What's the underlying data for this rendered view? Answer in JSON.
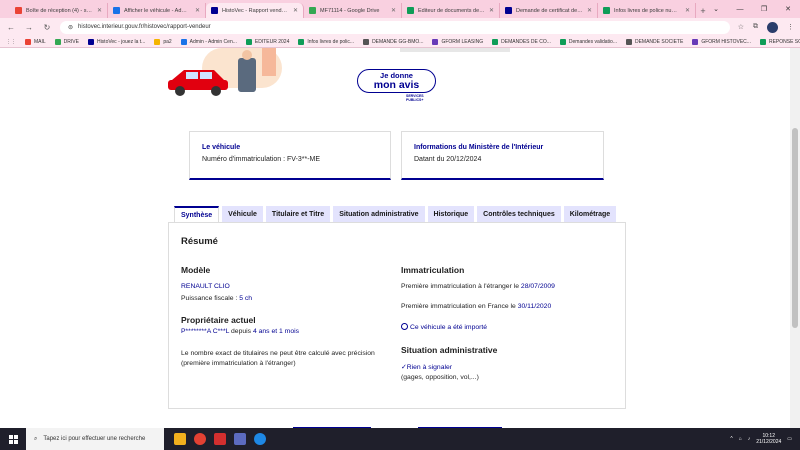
{
  "browser": {
    "tabs": [
      {
        "label": "Boîte de réception (4) - samarr",
        "color": "#ea4335"
      },
      {
        "label": "Afficher le véhicule - Admin Ce",
        "color": "#1a73e8"
      },
      {
        "label": "HistoVec - Rapport vendeur",
        "color": "#000091",
        "active": true
      },
      {
        "label": "MF71114 - Google Drive",
        "color": "#34a853"
      },
      {
        "label": "Editeur de documents de rech",
        "color": "#0f9d58"
      },
      {
        "label": "Demande de certificat de situ",
        "color": "#000091"
      },
      {
        "label": "Infos livres de police numériqu",
        "color": "#0f9d58"
      }
    ],
    "url": "histovec.interieur.gouv.fr/histovec/rapport-vendeur",
    "bookmarks": [
      {
        "label": "MAIL",
        "color": "#ea4335"
      },
      {
        "label": "DRIVE",
        "color": "#34a853"
      },
      {
        "label": "HistoVec - jouez la t...",
        "color": "#000091"
      },
      {
        "label": "pa2",
        "color": "#f4b400"
      },
      {
        "label": "Admin - Admin Cen...",
        "color": "#1a73e8"
      },
      {
        "label": "EDITEUR 2024",
        "color": "#0f9d58"
      },
      {
        "label": "Infos livres de polic...",
        "color": "#0f9d58"
      },
      {
        "label": "DEMANDE GG-BMO...",
        "color": "#555555"
      },
      {
        "label": "GFORM LEASING",
        "color": "#673ab7"
      },
      {
        "label": "DEMANDES DE CO...",
        "color": "#0f9d58"
      },
      {
        "label": "Demandes validatio...",
        "color": "#0f9d58"
      },
      {
        "label": "DEMANDE SOCIETE",
        "color": "#555555"
      },
      {
        "label": "GFORM HISTOVEC...",
        "color": "#673ab7"
      },
      {
        "label": "REPONSE SOCIETE",
        "color": "#0f9d58"
      }
    ]
  },
  "hero": {
    "feedback_l1": "Je donne",
    "feedback_l2": "mon avis",
    "services_l1": "SERVICES",
    "services_l2": "PUBLICS+"
  },
  "cards": {
    "vehicle": {
      "title": "Le véhicule",
      "text": "Numéro d'immatriculation : FV-3**-ME"
    },
    "ministry": {
      "title": "Informations du Ministère de l'Intérieur",
      "text": "Datant du 20/12/2024"
    }
  },
  "tabs": [
    "Synthèse",
    "Véhicule",
    "Titulaire et Titre",
    "Situation administrative",
    "Historique",
    "Contrôles techniques",
    "Kilométrage"
  ],
  "summary": {
    "title": "Résumé",
    "model_heading": "Modèle",
    "model": "RENAULT CLIO",
    "power_label": "Puissance fiscale :",
    "power_value": "5 ch",
    "owner_heading": "Propriétaire actuel",
    "owner_name": "P********A C***L",
    "owner_since_label": "depuis",
    "owner_since_value": "4 ans et 1 mois",
    "owners_note": "Le nombre exact de titulaires ne peut être calculé avec précision (première immatriculation à l'étranger)",
    "immat_heading": "Immatriculation",
    "first_foreign_label": "Première immatriculation à l'étranger le",
    "first_foreign_date": "28/07/2009",
    "first_fr_label": "Première immatriculation en France le",
    "first_fr_date": "30/11/2020",
    "imported": "Ce véhicule a été importé",
    "admin_heading": "Situation administrative",
    "admin_status": "Rien à signaler",
    "admin_detail": "(gages, opposition, vol,...)"
  },
  "taskbar": {
    "search_placeholder": "Tapez ici pour effectuer une recherche",
    "time": "10:12",
    "date": "21/12/2024"
  }
}
